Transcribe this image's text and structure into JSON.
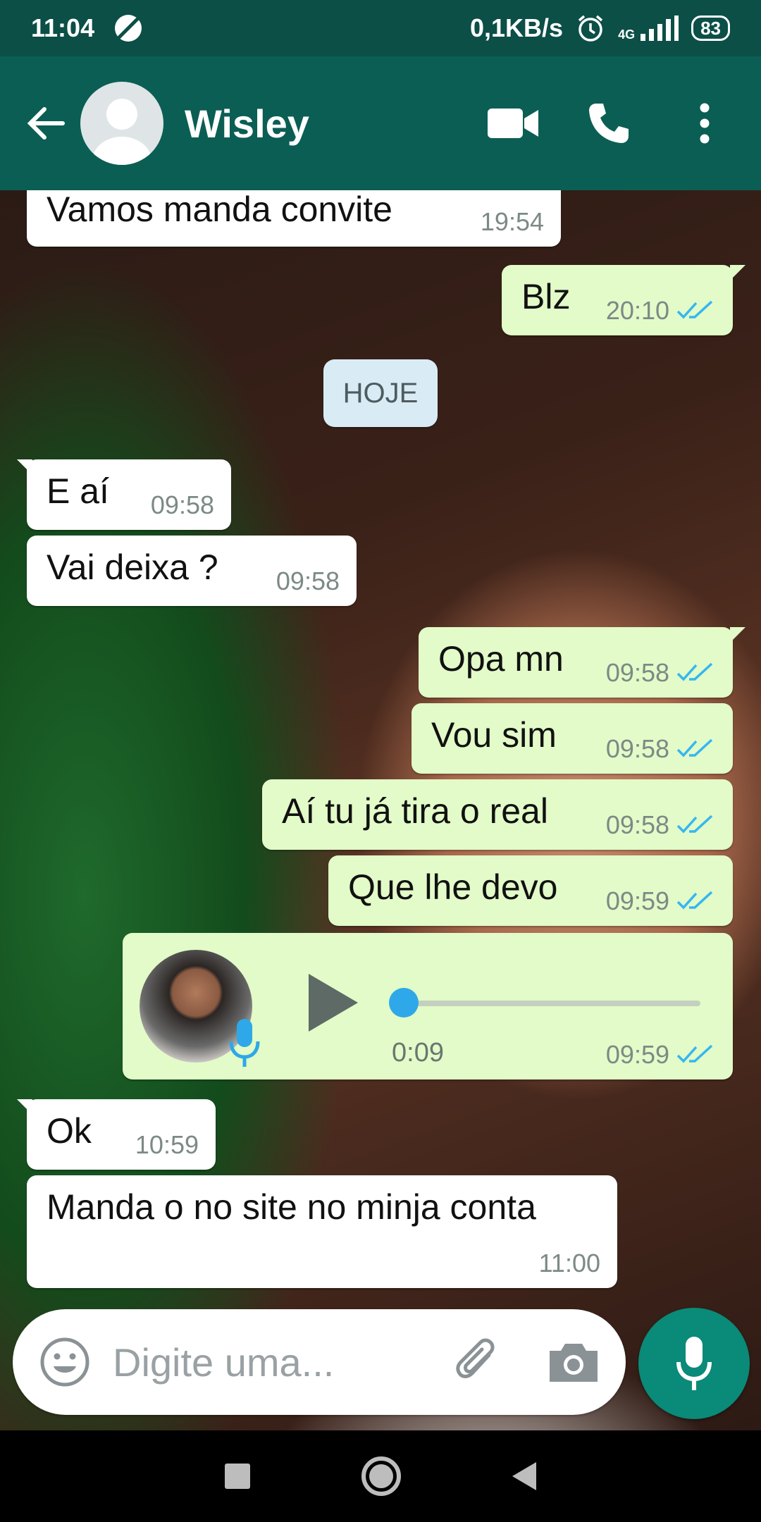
{
  "status_bar": {
    "time": "11:04",
    "network_speed": "0,1KB/s",
    "network_type": "4G",
    "battery": "83"
  },
  "header": {
    "contact_name": "Wisley",
    "icons": [
      "back-arrow-icon",
      "video-call-icon",
      "phone-icon",
      "more-options-icon"
    ]
  },
  "messages": [
    {
      "direction": "in",
      "text": "Vamos manda convite",
      "time": "19:54"
    },
    {
      "direction": "out",
      "text": "Blz",
      "time": "20:10",
      "read": true
    },
    {
      "type": "date",
      "text": "HOJE"
    },
    {
      "direction": "in",
      "text": "E aí",
      "time": "09:58"
    },
    {
      "direction": "in",
      "text": "Vai deixa ?",
      "time": "09:58"
    },
    {
      "direction": "out",
      "text": "Opa mn",
      "time": "09:58",
      "read": true
    },
    {
      "direction": "out",
      "text": "Vou sim",
      "time": "09:58",
      "read": true
    },
    {
      "direction": "out",
      "text": "Aí tu já tira o real",
      "time": "09:58",
      "read": true
    },
    {
      "direction": "out",
      "text": "Que lhe devo",
      "time": "09:59",
      "read": true
    },
    {
      "direction": "out",
      "type": "voice",
      "duration": "0:09",
      "time": "09:59",
      "read": true,
      "progress": 0
    },
    {
      "direction": "in",
      "text": "Ok",
      "time": "10:59"
    },
    {
      "direction": "in",
      "text": "Manda o no site no minja conta",
      "time": "11:00"
    }
  ],
  "input": {
    "placeholder": "Digite uma..."
  },
  "colors": {
    "header": "#0b5e54",
    "status_bar": "#0b4f47",
    "outgoing_bubble": "#e2fbc8",
    "incoming_bubble": "#ffffff",
    "read_ticks": "#34b7f1",
    "mic_button": "#0a8a78",
    "date_chip": "#d9ecf6"
  }
}
